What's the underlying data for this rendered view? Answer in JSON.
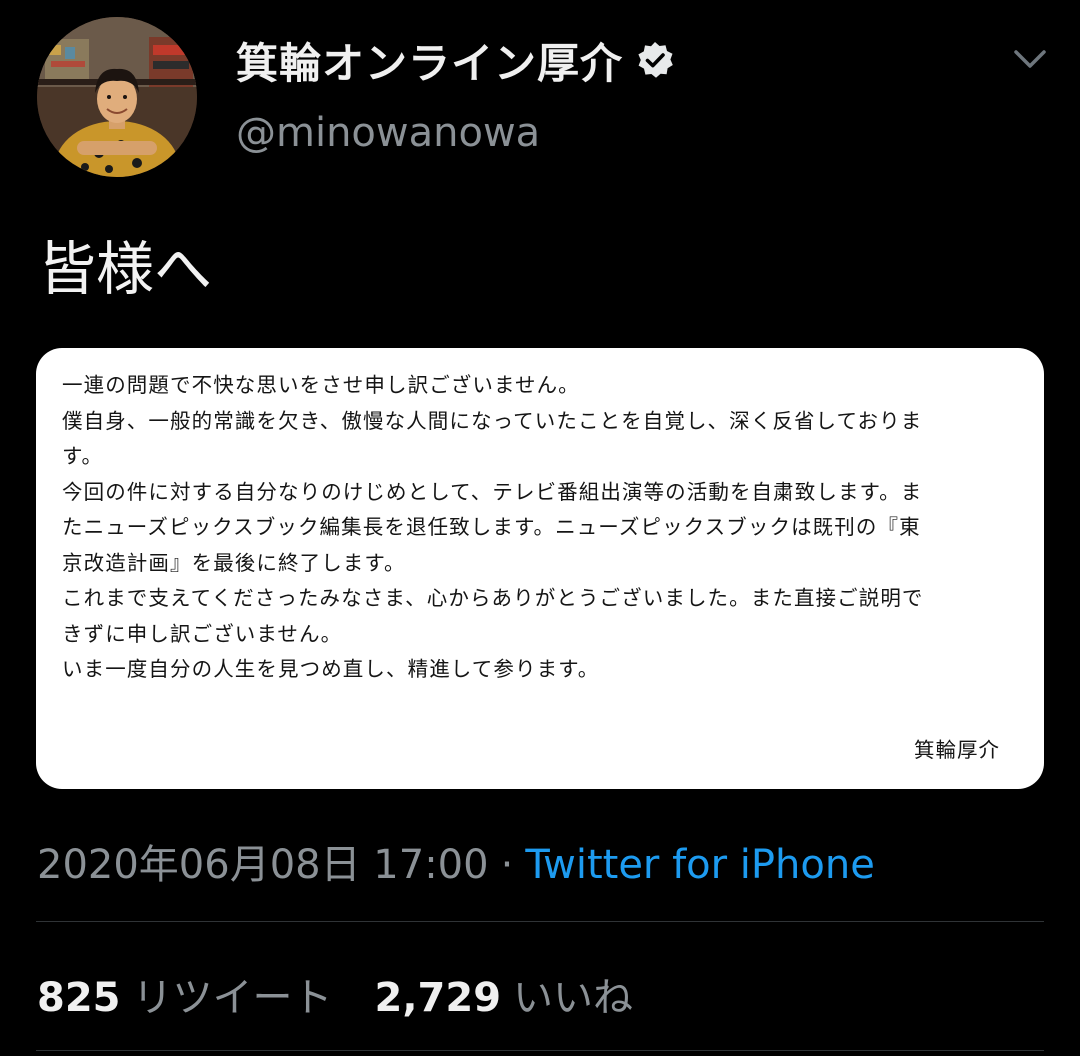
{
  "author": {
    "display_name": "箕輪オンライン厚介",
    "handle": "@minowanowa",
    "verified": true,
    "avatar_icon": "profile-photo"
  },
  "tweet": {
    "text": "皆様へ",
    "menu_icon": "chevron-down-icon"
  },
  "media": {
    "lines": [
      "一連の問題で不快な思いをさせ申し訳ございません。",
      "僕自身、一般的常識を欠き、傲慢な人間になっていたことを自覚し、深く反省しておりま",
      "す。",
      "今回の件に対する自分なりのけじめとして、テレビ番組出演等の活動を自粛致します。ま",
      "たニューズピックスブック編集長を退任致します。ニューズピックスブックは既刊の『東",
      "京改造計画』を最後に終了します。",
      "これまで支えてくださったみなさま、心からありがとうございました。また直接ご説明で",
      "きずに申し訳ございません。",
      "いま一度自分の人生を見つめ直し、精進して参ります。"
    ],
    "signature": "箕輪厚介"
  },
  "meta": {
    "timestamp": "2020年06月08日 17:00",
    "separator": "·",
    "source": "Twitter for iPhone"
  },
  "stats": {
    "retweets_count": "825",
    "retweets_label": "リツイート",
    "likes_count": "2,729",
    "likes_label": "いいね"
  },
  "colors": {
    "background": "#000000",
    "secondary_text": "#8b9196",
    "link": "#1d9bf0",
    "divider": "#2f3336"
  }
}
